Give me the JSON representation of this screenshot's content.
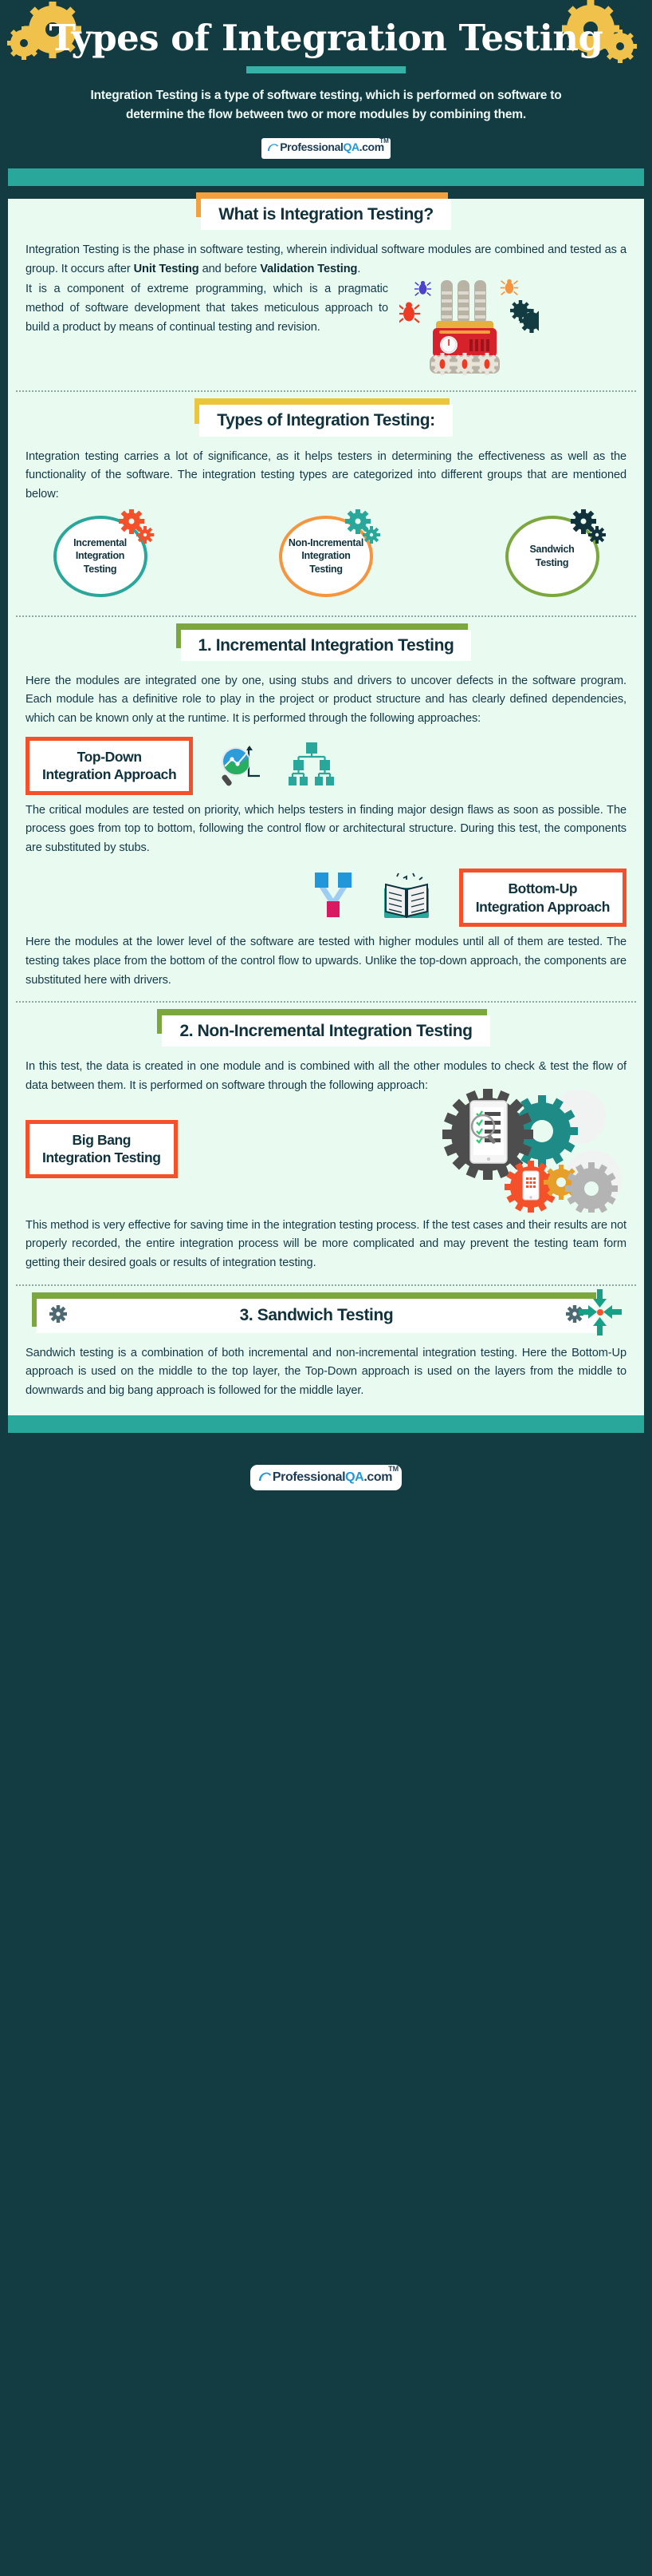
{
  "header": {
    "title": "Types of Integration Testing",
    "subtitle": "Integration Testing is a type of software testing, which is performed on software to determine the flow between two or more modules by combining them.",
    "logo": {
      "pro": "Professional",
      "qa": "QA",
      "dotcom": ".com",
      "tm": "TM"
    }
  },
  "colors": {
    "dark_teal": "#123b42",
    "teal_bar": "#2aa79b",
    "panel_bg": "#e9fbf1",
    "orange_accent": "#f4a03c",
    "yellow_accent": "#e9c63c",
    "olive_accent": "#7ba73e",
    "red_border": "#f4502a",
    "circle_teal": "#2aa79b",
    "circle_orange": "#f7943e",
    "circle_olive": "#7ba73e"
  },
  "sections": [
    {
      "id": "what-is",
      "heading": "What is Integration Testing?",
      "accent": "#f4a03c",
      "paragraph_1_pre": "Integration Testing is the phase in software testing, wherein individual software modules are combined and tested as a group. It occurs after ",
      "paragraph_1_bold_1": "Unit Testing",
      "paragraph_1_mid": " and before ",
      "paragraph_1_bold_2": "Validation Testing",
      "paragraph_1_post": ".",
      "paragraph_2": "It is a component of extreme programming, which is a pragmatic method of software development that takes meticulous approach to build a product by means of continual testing and revision."
    },
    {
      "id": "types",
      "heading": "Types of Integration Testing:",
      "accent": "#e9c63c",
      "paragraph_1": "Integration testing carries a lot of significance, as it helps testers in determining the effectiveness as well as the functionality of the software. The integration testing types are categorized into different groups that are mentioned below:"
    },
    {
      "id": "incremental",
      "heading": "1. Incremental Integration Testing",
      "accent": "#7ba73e",
      "paragraph_1": "Here the modules are integrated one by one, using stubs and drivers to uncover defects in the software program. Each module has a definitive role to play in the project or product structure and has clearly defined dependencies, which can be known only at the runtime. It is performed through the following approaches:"
    },
    {
      "id": "non-incremental",
      "heading": "2. Non-Incremental Integration Testing",
      "accent": "#7ba73e",
      "paragraph_1": "In this test, the data is created in one module and is combined with all the other modules to check & test the flow of data between them. It is performed on software through the following approach:"
    },
    {
      "id": "sandwich",
      "heading": "3. Sandwich Testing",
      "accent": "#7ba73e",
      "paragraph_1": "Sandwich testing is a combination of both incremental and non-incremental integration testing. Here the Bottom-Up approach is used on the middle to the top layer, the Top-Down approach is used on the layers from the middle to downwards and big bang approach is followed for the middle layer."
    }
  ],
  "circles": [
    {
      "label": "Incremental Integration Testing",
      "color": "#2aa79b",
      "gear_color": "#f4502a"
    },
    {
      "label": "Non-Incremental Integration Testing",
      "color": "#f7943e",
      "gear_color": "#2aa79b"
    },
    {
      "label": "Sandwich Testing",
      "color": "#7ba73e",
      "gear_color": "#10323c"
    }
  ],
  "approaches": [
    {
      "id": "top-down",
      "label_line_1": "Top-Down",
      "label_line_2": "Integration Approach",
      "description": "The critical modules are tested on priority, which helps testers in finding major design flaws as soon as possible. The process goes from top to bottom, following the control flow or architectural structure. During this test, the components are substituted by stubs."
    },
    {
      "id": "bottom-up",
      "label_line_1": "Bottom-Up",
      "label_line_2": "Integration Approach",
      "description": "Here the modules at the lower level of the software are tested with higher modules until all of them are tested. The testing takes place from the bottom of the control flow to upwards. Unlike the top-down approach, the components are substituted here with drivers."
    },
    {
      "id": "big-bang",
      "label_line_1": "Big Bang",
      "label_line_2": "Integration Testing",
      "description": "This method is very effective for saving time in the integration testing process. If the test cases and their results are not properly recorded, the entire integration process will be more complicated and may prevent the testing team form getting their desired goals or results of integration testing."
    }
  ],
  "footer": {
    "logo": {
      "pro": "Professional",
      "qa": "QA",
      "dotcom": ".com",
      "tm": "TM"
    }
  }
}
